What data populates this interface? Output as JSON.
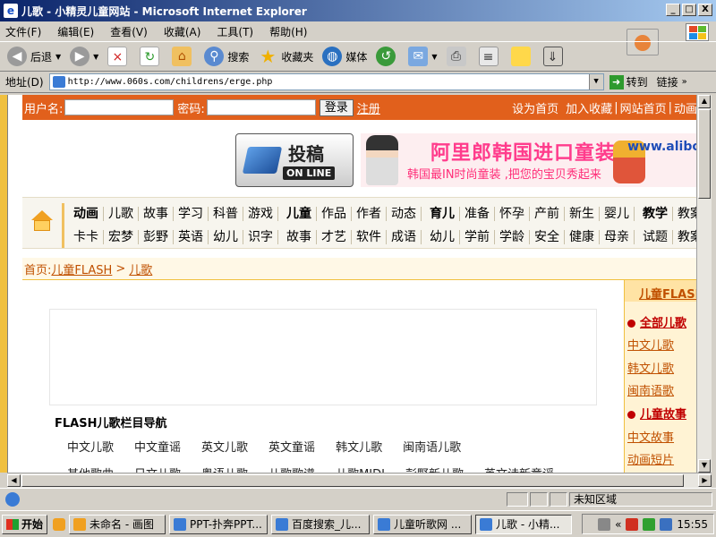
{
  "window": {
    "title": "儿歌 - 小精灵儿童网站 - Microsoft Internet Explorer",
    "min": "_",
    "max": "□",
    "close": "X"
  },
  "menu": [
    "文件(F)",
    "编辑(E)",
    "查看(V)",
    "收藏(A)",
    "工具(T)",
    "帮助(H)"
  ],
  "toolbar": {
    "back": "后退",
    "search": "搜索",
    "favorites": "收藏夹",
    "media": "媒体"
  },
  "address": {
    "label": "地址(D)",
    "url": "http://www.060s.com/childrens/erge.php",
    "go": "转到",
    "links": "链接"
  },
  "login": {
    "user_label": "用户名:",
    "pass_label": "密码:",
    "login_button": "登录",
    "register": "注册",
    "top_links": [
      "设为首页",
      "加入收藏",
      "网站首页",
      "动画"
    ]
  },
  "banner": {
    "tougao_main": "投稿",
    "tougao_sub": "ON LINE",
    "ad_headline": "阿里郎韩国进口童装",
    "ad_slogan": "韩国最IN时尚童装 ,把您的宝贝秀起来",
    "ad_url": "www.alibo"
  },
  "nav": {
    "row1": [
      {
        "t": "动画",
        "b": true
      },
      {
        "t": "儿歌"
      },
      {
        "t": "故事"
      },
      {
        "t": "学习"
      },
      {
        "t": "科普"
      },
      {
        "t": "游戏"
      },
      {
        "t": "儿童",
        "b": true
      },
      {
        "t": "作品"
      },
      {
        "t": "作者"
      },
      {
        "t": "动态"
      },
      {
        "t": "育儿",
        "b": true
      },
      {
        "t": "准备"
      },
      {
        "t": "怀孕"
      },
      {
        "t": "产前"
      },
      {
        "t": "新生"
      },
      {
        "t": "婴儿"
      },
      {
        "t": "教学",
        "b": true
      },
      {
        "t": "教案"
      }
    ],
    "row2": [
      {
        "t": "卡卡"
      },
      {
        "t": "宏梦"
      },
      {
        "t": "彭野"
      },
      {
        "t": "英语"
      },
      {
        "t": "幼儿"
      },
      {
        "t": "识字"
      },
      {
        "t": "故事"
      },
      {
        "t": "才艺"
      },
      {
        "t": "软件"
      },
      {
        "t": "成语"
      },
      {
        "t": "幼儿"
      },
      {
        "t": "学前"
      },
      {
        "t": "学龄"
      },
      {
        "t": "安全"
      },
      {
        "t": "健康"
      },
      {
        "t": "母亲"
      },
      {
        "t": "试题"
      },
      {
        "t": "教案"
      }
    ]
  },
  "breadcrumb": {
    "home": "首页:",
    "section": "儿童FLASH",
    "sep": ">",
    "current": "儿歌"
  },
  "flash_nav": {
    "title": "FLASH儿歌栏目导航",
    "row1": [
      "中文儿歌",
      "中文童谣",
      "英文儿歌",
      "英文童谣",
      "韩文儿歌",
      "闽南语儿歌"
    ],
    "row2": [
      "其他歌曲",
      "日文儿歌",
      "粤语儿歌",
      "儿歌歌谱",
      "儿歌MIDI",
      "彭野新儿歌",
      "英文诗新童谣"
    ]
  },
  "sidebar": {
    "head": "儿童FLASH",
    "cat1": "全部儿歌",
    "items1": [
      "中文儿歌",
      "韩文儿歌",
      "闽南语歌"
    ],
    "cat2": "儿童故事",
    "items2": [
      "中文故事",
      "动画短片"
    ]
  },
  "status": {
    "zone": "未知区域"
  },
  "taskbar": {
    "start": "开始",
    "tasks": [
      "未命名 - 画图",
      "PPT-扑奔PPT...",
      "百度搜索_儿...",
      "儿童听歌网 ...",
      "儿歌 - 小精..."
    ],
    "time": "15:55"
  },
  "colors": {
    "login_bar": "#e1601c",
    "link": "#c05000",
    "accent": "#f0c040"
  }
}
